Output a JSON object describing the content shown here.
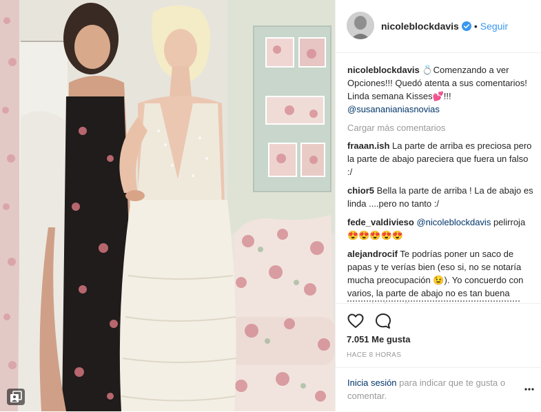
{
  "header": {
    "username": "nicoleblockdavis",
    "separator": "•",
    "follow_label": "Seguir"
  },
  "caption": {
    "author": "nicoleblockdavis",
    "text": "💍Comenzando a ver Opciones!!! Quedó atenta a sus comentarios! Linda semana Kisses💕!!!",
    "mention": "@susananianiasnovias"
  },
  "load_more_label": "Cargar más comentarios",
  "comments": [
    {
      "author": "fraaan.ish",
      "text": "La parte de arriba es preciosa pero la parte de abajo pareciera que fuera un falso :/"
    },
    {
      "author": "chior5",
      "text": "Bella la parte de arriba ! La de abajo es linda ....pero no tanto :/"
    },
    {
      "author": "fede_valdivieso",
      "mention": "@nicoleblockdavis",
      "text": "pelirroja 😍😍😍😍😍"
    },
    {
      "author": "alejandrocif",
      "text": "Te podrías poner un saco de papas y te verías bien (eso si, no se notaría mucha preocupación 😉). Yo concuerdo con varios, la parte de abajo no es tan buena como la de arriba."
    }
  ],
  "icons": {
    "like": "heart-outline-icon",
    "comment": "speech-bubble-icon",
    "verified": "verified-badge-icon",
    "multiple": "multiple-photos-icon",
    "more": "more-options-icon"
  },
  "likes_text": "7.051 Me gusta",
  "timestamp": "HACE 8 HORAS",
  "footer": {
    "login_link": "Inicia sesión",
    "login_text": " para indicar que te gusta o comentar."
  },
  "colors": {
    "link_blue": "#3897f0",
    "mention_navy": "#003569",
    "muted_gray": "#999999",
    "text": "#262626"
  }
}
